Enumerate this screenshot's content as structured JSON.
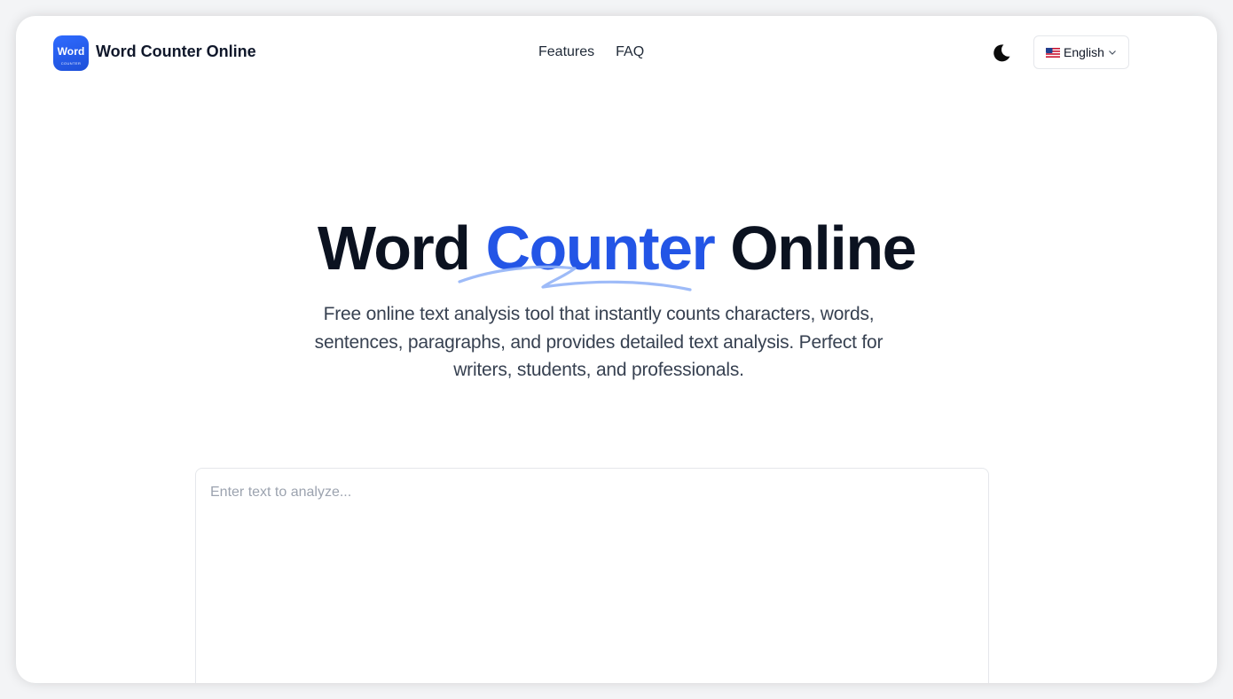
{
  "brand": {
    "logo_word": "Word",
    "logo_sub": "COUNTER",
    "name": "Word Counter Online",
    "accent_color": "#2355e6"
  },
  "nav": {
    "items": [
      {
        "label": "Features"
      },
      {
        "label": "FAQ"
      }
    ]
  },
  "header": {
    "theme_icon": "moon-icon",
    "language": {
      "flag_icon": "us-flag-icon",
      "selected": "English",
      "chevron_icon": "chevron-down-icon"
    }
  },
  "hero": {
    "title_before": "Word ",
    "title_accent": "Counter",
    "title_after": " Online",
    "subtitle": "Free online text analysis tool that instantly counts characters, words, sentences, paragraphs, and provides detailed text analysis. Perfect for writers, students, and professionals."
  },
  "editor": {
    "placeholder": "Enter text to analyze...",
    "value": ""
  }
}
